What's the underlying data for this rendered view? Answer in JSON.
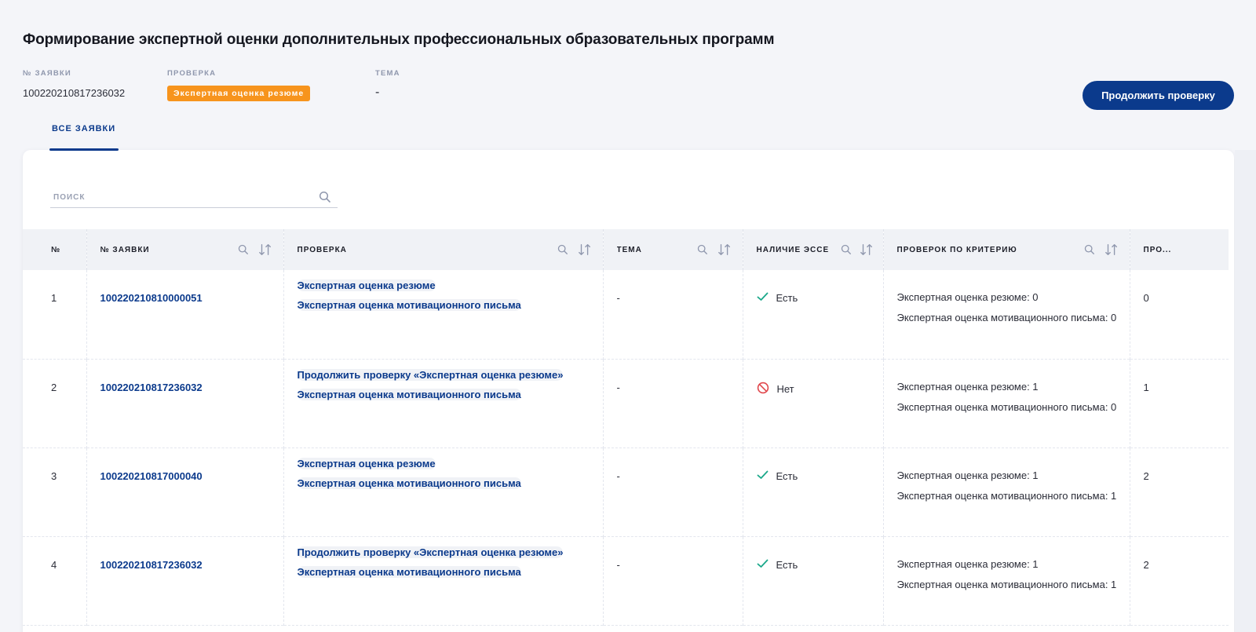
{
  "title": "Формирование экспертной оценки дополнительных профессиональных образовательных программ",
  "meta": {
    "application_label": "№ заявки",
    "application_value": "100220210817236032",
    "check_label": "Проверка",
    "check_value": "Экспертная оценка резюме",
    "topic_label": "Тема",
    "topic_value": "-"
  },
  "continue_button": "Продолжить проверку",
  "tabs": [
    {
      "label": "Все заявки",
      "active": true
    }
  ],
  "search": {
    "placeholder": "поиск"
  },
  "colors": {
    "accent": "#0b3a8c",
    "badge": "#f7941d",
    "ok": "#1aa88a",
    "no": "#e0474c"
  },
  "table": {
    "headers": {
      "num": "№",
      "application": "№ заявки",
      "check": "Проверка",
      "topic": "Тема",
      "essay": "Наличие эссе",
      "criteria": "Проверок по критерию",
      "last": "Про..."
    },
    "rows": [
      {
        "num": "1",
        "application": "100220210810000051",
        "checks": [
          "Экспертная оценка резюме",
          "Экспертная оценка мотивационного письма"
        ],
        "topic": "-",
        "essay": "Есть",
        "essay_icon": "check-icon",
        "criteria": [
          "Экспертная оценка резюме: 0",
          "Экспертная оценка мотивационного письма: 0"
        ],
        "last": "0"
      },
      {
        "num": "2",
        "application": "100220210817236032",
        "checks": [
          "Продолжить проверку «Экспертная оценка резюме»",
          "Экспертная оценка мотивационного письма"
        ],
        "topic": "-",
        "essay": "Нет",
        "essay_icon": "no-entry-icon",
        "criteria": [
          "Экспертная оценка резюме: 1",
          "Экспертная оценка мотивационного письма: 0"
        ],
        "last": "1"
      },
      {
        "num": "3",
        "application": "100220210817000040",
        "checks": [
          "Экспертная оценка резюме",
          "Экспертная оценка мотивационного письма"
        ],
        "topic": "-",
        "essay": "Есть",
        "essay_icon": "check-icon",
        "criteria": [
          "Экспертная оценка резюме: 1",
          "Экспертная оценка мотивационного письма: 1"
        ],
        "last": "2"
      },
      {
        "num": "4",
        "application": "100220210817236032",
        "checks": [
          "Продолжить проверку «Экспертная оценка резюме»",
          "Экспертная оценка мотивационного письма"
        ],
        "topic": "-",
        "essay": "Есть",
        "essay_icon": "check-icon",
        "criteria": [
          "Экспертная оценка резюме: 1",
          "Экспертная оценка мотивационного письма: 1"
        ],
        "last": "2"
      }
    ]
  }
}
